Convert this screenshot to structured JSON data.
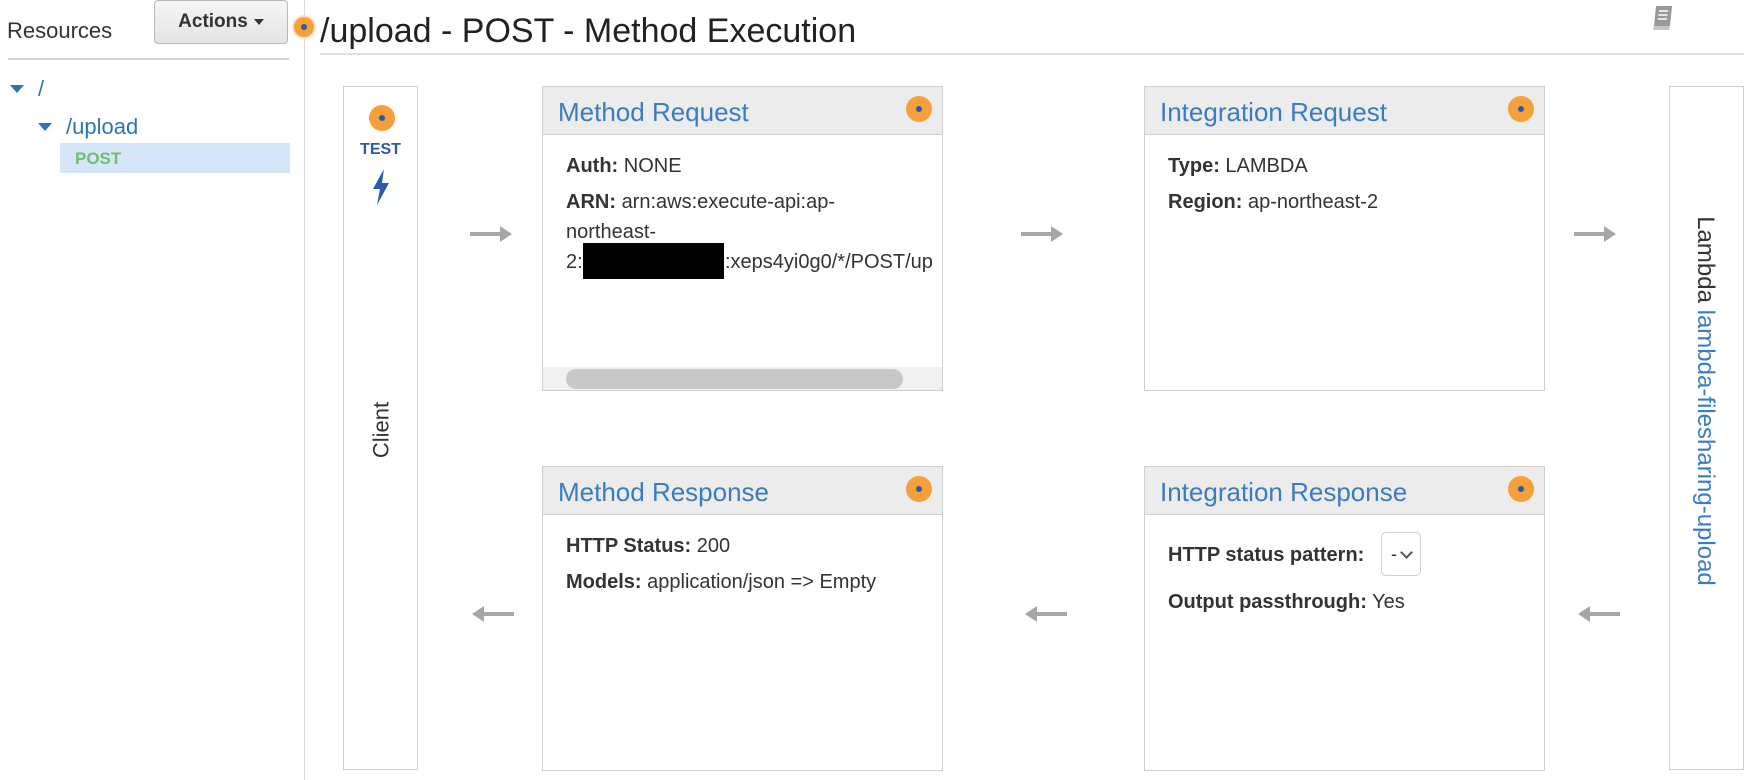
{
  "sidebar": {
    "resources_label": "Resources",
    "actions_label": "Actions",
    "tree": [
      {
        "label": "/"
      },
      {
        "label": "/upload"
      },
      {
        "label": "POST"
      }
    ]
  },
  "header": {
    "title": "/upload - POST - Method Execution"
  },
  "client": {
    "test_label": "TEST",
    "label": "Client"
  },
  "method_request": {
    "title": "Method Request",
    "auth_key": "Auth:",
    "auth_value": "NONE",
    "arn_key": "ARN:",
    "arn_line1": "arn:aws:execute-api:ap-",
    "arn_line2": "northeast-",
    "arn_line3_prefix": "2:",
    "arn_line3_suffix": ":xeps4yi0g0/*/POST/up"
  },
  "integration_request": {
    "title": "Integration Request",
    "type_key": "Type:",
    "type_value": "LAMBDA",
    "region_key": "Region:",
    "region_value": "ap-northeast-2"
  },
  "method_response": {
    "title": "Method Response",
    "status_key": "HTTP Status:",
    "status_value": "200",
    "models_key": "Models:",
    "models_value": "application/json => Empty"
  },
  "integration_response": {
    "title": "Integration Response",
    "pattern_key": "HTTP status pattern:",
    "pattern_value": "-",
    "passthrough_key": "Output passthrough:",
    "passthrough_value": "Yes"
  },
  "lambda": {
    "prefix": "Lambda",
    "function_name": "lambda-filesharing-upload"
  },
  "colors": {
    "accent_blue": "#3a7cc2",
    "status_orange": "#f5a03a",
    "selected_row": "#d5e6f8",
    "method_green": "#6fbf73"
  }
}
